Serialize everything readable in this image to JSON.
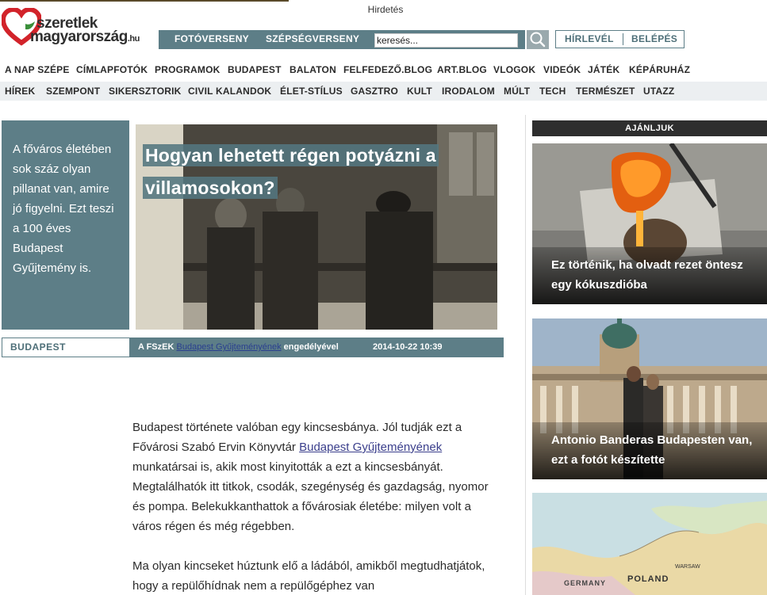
{
  "ad": {
    "label": "Hirdetés"
  },
  "logo": {
    "line1": "szeretlek",
    "line2": "magyarország",
    "tld": ".hu"
  },
  "topbar": {
    "links": [
      "FOTÓVERSENY",
      "SZÉPSÉGVERSENY"
    ],
    "search_value": "keresés...",
    "account": [
      "HÍRLEVÉL",
      "BELÉPÉS"
    ]
  },
  "nav1": [
    "A NAP SZÉPE",
    "CÍMLAPFOTÓK",
    "PROGRAMOK",
    "BUDAPEST",
    "BALATON",
    "FELFEDEZŐ.BLOG",
    "ART.BLOG",
    "VLOGOK",
    "VIDEÓK",
    "JÁTÉK",
    "KÉPÁRUHÁZ"
  ],
  "nav2": [
    "HÍREK",
    "SZEMPONT",
    "SIKERSZTORIK",
    "CIVIL KALANDOK",
    "ÉLET-STÍLUS",
    "GASZTRO",
    "KULT",
    "IRODALOM",
    "MÚLT",
    "TECH",
    "TERMÉSZET",
    "UTAZZ"
  ],
  "article": {
    "intro": "A főváros életében sok száz olyan pillanat van, amire jó figyelni. Ezt teszi a 100 éves Budapest Gyűjtemény is.",
    "title": "Hogyan lehetett régen potyázni a villamosokon?",
    "category": "BUDAPEST",
    "credit_prefix": "A FSzEK ",
    "credit_link": "Budapest Gyűjteményének",
    "credit_suffix": " engedélyével",
    "date": "2014-10-22 10:39",
    "p1_a": "Budapest története valóban egy kincsesbánya. Jól tudják ezt a Fővárosi Szabó Ervin Könyvtár ",
    "p1_link": "Budapest Gyűjteményének",
    "p1_b": " munkatársai is, akik most kinyitották a ezt a kincsesbányát. Megtalálhatók itt titkok, csodák, szegénység és gazdagság, nyomor és pompa. Belekukkanthattok a fővárosiak életébe: milyen volt a város régen és még régebben.",
    "p2": "Ma olyan kincseket húztunk elő a ládából, amikből megtudhatjátok, hogy a repülőhídnak nem a repülőgéphez van"
  },
  "sidebar": {
    "heading": "AJÁNLJUK",
    "cards": [
      {
        "title": "Ez történik, ha olvadt rezet öntesz egy kókuszdióba"
      },
      {
        "title": "Antonio Banderas Budapesten van, ezt a fotót készítette"
      },
      {
        "title": ""
      }
    ],
    "map_labels": [
      "GERMANY",
      "POLAND",
      "WARSAW"
    ]
  },
  "colors": {
    "accent": "#5d7e87",
    "logo_red": "#d2232a",
    "logo_green": "#3a8f3a"
  }
}
